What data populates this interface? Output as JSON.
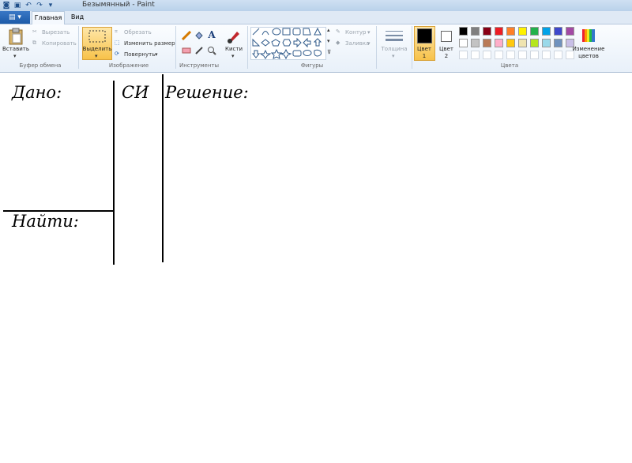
{
  "window": {
    "title": "Безымянный - Paint"
  },
  "tabs": {
    "file": "▤ ▾",
    "home": "Главная",
    "view": "Вид"
  },
  "clipboard": {
    "paste": "Вставить",
    "cut": "Вырезать",
    "copy": "Копировать",
    "group": "Буфер обмена"
  },
  "image": {
    "select": "Выделить",
    "crop": "Обрезать",
    "resize": "Изменить размер",
    "rotate": "Повернуть",
    "group": "Изображение"
  },
  "tools": {
    "group": "Инструменты"
  },
  "brushes": {
    "label": "Кисти"
  },
  "shapes": {
    "group": "Фигуры",
    "outline": "Контур",
    "fill": "Заливка"
  },
  "size": {
    "label": "Толщина"
  },
  "colors": {
    "color1": "Цвет 1",
    "color2": "Цвет 2",
    "edit": "Изменение цветов",
    "group": "Цвета",
    "palette": [
      "#000000",
      "#7f7f7f",
      "#880015",
      "#ed1c24",
      "#ff7f27",
      "#fff200",
      "#22b14c",
      "#00a2e8",
      "#3f48cc",
      "#a349a4",
      "#ffffff",
      "#c3c3c3",
      "#b97a57",
      "#ffaec9",
      "#ffc90e",
      "#efe4b0",
      "#b5e61d",
      "#99d9ea",
      "#7092be",
      "#c8bfe7"
    ]
  },
  "canvas": {
    "given": "Дано:",
    "si": "СИ",
    "solution": "Решение:",
    "find": "Найти:"
  }
}
